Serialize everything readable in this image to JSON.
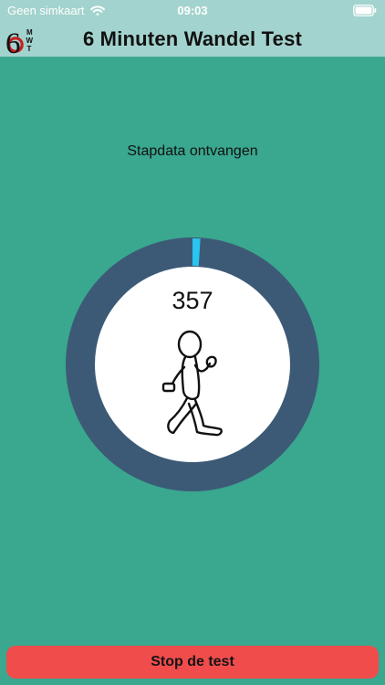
{
  "status_bar": {
    "carrier": "Geen simkaart",
    "time": "09:03",
    "icons": [
      "wifi-icon",
      "battery-icon"
    ]
  },
  "nav": {
    "logo_digit": "6",
    "logo_letters": [
      "M",
      "W",
      "T"
    ],
    "title": "6 Minuten Wandel Test"
  },
  "main": {
    "status_text": "Stapdata ontvangen",
    "step_count": "357",
    "progress_fraction": 0.01,
    "figure_icon": "walking-person-icon"
  },
  "footer": {
    "stop_label": "Stop de test"
  },
  "colors": {
    "background": "#3aa78f",
    "header": "#a3d3ce",
    "ring_track": "#3c5a76",
    "ring_progress": "#29c4f0",
    "stop_button": "#f04c4c",
    "logo_accent": "#c81f1f"
  }
}
